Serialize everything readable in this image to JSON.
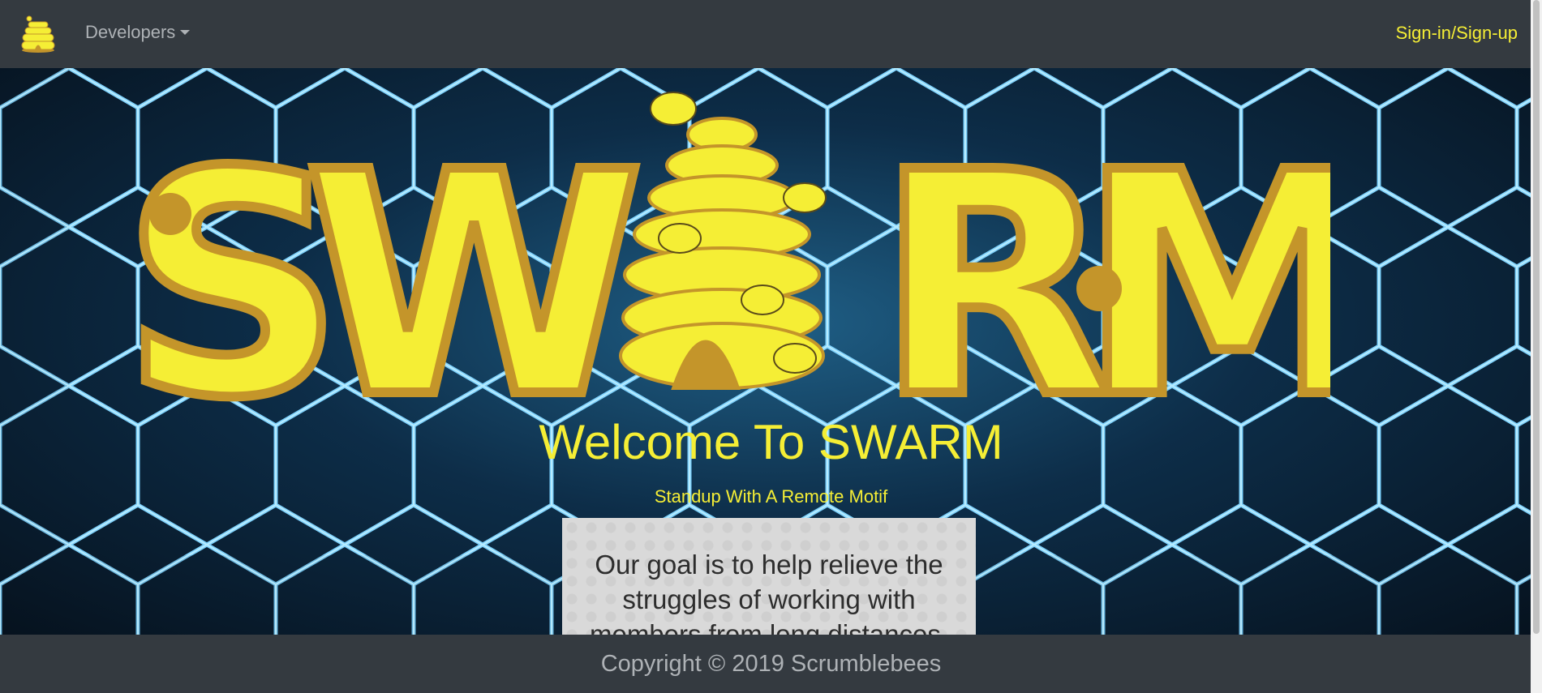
{
  "nav": {
    "brand_icon": "beehive-icon",
    "developers_label": "Developers",
    "signin_label": "Sign-in/Sign-up"
  },
  "hero": {
    "logo_text": "SWARM",
    "logo_icons": [
      "beehive-icon",
      "bee-icon",
      "flower-icon"
    ],
    "welcome": "Welcome To SWARM",
    "tagline": "Standup With A Remote Motif",
    "goal_text": "Our goal is to help relieve the struggles of working with members from long distances."
  },
  "footer": {
    "copyright": "Copyright © 2019 Scrumblebees"
  },
  "colors": {
    "accent": "#f5ee35",
    "logo_outline": "#c4952a",
    "navbar": "#343a40",
    "hex_glow": "#7fd4ff"
  }
}
